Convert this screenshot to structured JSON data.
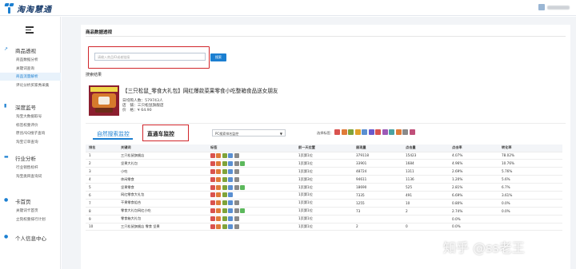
{
  "app": {
    "title": "淘淘慧通"
  },
  "sidebar": {
    "sections": [
      {
        "label": "商品透视",
        "icon": "chart-line-icon",
        "items": [
          "商品数据分析",
          "关键词查询",
          "商品流量解析",
          "评论分析买家秀采集"
        ]
      },
      {
        "label": "深度监号",
        "icon": "chart-bar-icon",
        "items": [
          "淘宝大数据取号",
          "标签权重评价",
          "原创/QQ搜子查询",
          "淘宝订单查询"
        ]
      },
      {
        "label": "行业分析",
        "icon": "folder-icon",
        "items": [
          "行业销售标杆",
          "淘宝类目查询词"
        ]
      },
      {
        "label": "卡首页",
        "icon": "info-icon",
        "items": [
          "关键词卡首页",
          "立刻权重排行计划"
        ]
      },
      {
        "label": "个人信息中心",
        "icon": "user-icon",
        "items": []
      }
    ]
  },
  "panel": {
    "title": "商品数据透视",
    "search_placeholder": "请输入商品ID或者链接",
    "search_button": "搜索",
    "result_label": "搜索结果"
  },
  "product": {
    "title": "【三只松鼠_零食大礼包】网红爆款菜果零食小吃整箱食品送女朋友",
    "sales": "日均购人数：579743人",
    "shop": "店　铺：三只松鼠旗舰店",
    "price": "价　格：¥ 64.90"
  },
  "tabs": {
    "organic": "自然搜索监控",
    "paid": "直通车监控"
  },
  "select": {
    "value": "PC搜索排名监控"
  },
  "filter_label": "选择标签：",
  "filter_colors": [
    "#d9534f",
    "#e07b39",
    "#7fa33a",
    "#e0a12a",
    "#5a8fd1",
    "#6a5acd",
    "#d9534f",
    "#9c59b6",
    "#4aa3a3",
    "#e07b39",
    "#8a8a8a",
    "#c04f7a"
  ],
  "table": {
    "headers": [
      "排名",
      "关键词",
      "标签",
      "前一天位置",
      "展现量",
      "点击量",
      "点击率",
      "转化率"
    ],
    "rows": [
      {
        "rank": "1",
        "kw": "三只松鼠旗舰店",
        "tags": [
          "#d9534f",
          "#e07b39",
          "#7fa33a",
          "#5a8fd1",
          "#8a8a8a"
        ],
        "pos": "1页第1位",
        "imp": "379118",
        "clk": "15423",
        "ctr": "4.07%",
        "cvr": "78.02%"
      },
      {
        "rank": "2",
        "kw": "坚果大礼包",
        "tags": [
          "#d9534f",
          "#e07b39",
          "#7fa33a",
          "#5a8fd1",
          "#8a8a8a",
          "#5cb85c"
        ],
        "pos": "1页第1位",
        "imp": "33901",
        "clk": "1684",
        "ctr": "4.96%",
        "cvr": "10.76%"
      },
      {
        "rank": "3",
        "kw": "小吃",
        "tags": [
          "#d9534f",
          "#e07b39",
          "#7fa33a",
          "#5a8fd1",
          "#8a8a8a"
        ],
        "pos": "1页第1位",
        "imp": "48724",
        "clk": "1311",
        "ctr": "2.69%",
        "cvr": "5.76%"
      },
      {
        "rank": "4",
        "kw": "休闲零食",
        "tags": [
          "#d9534f",
          "#e07b39",
          "#7fa33a",
          "#5a8fd1",
          "#8a8a8a"
        ],
        "pos": "1页第3位",
        "imp": "94611",
        "clk": "1136",
        "ctr": "1.20%",
        "cvr": "5.6%"
      },
      {
        "rank": "5",
        "kw": "坚果零食",
        "tags": [
          "#d9534f",
          "#e07b39",
          "#7fa33a",
          "#5a8fd1",
          "#8a8a8a",
          "#5cb85c"
        ],
        "pos": "1页第1位",
        "imp": "18690",
        "clk": "525",
        "ctr": "2.81%",
        "cvr": "6.7%"
      },
      {
        "rank": "6",
        "kw": "网红零食大礼包",
        "tags": [
          "#d9534f",
          "#e07b39",
          "#7fa33a",
          "#5a8fd1"
        ],
        "pos": "1页第1位",
        "imp": "7335",
        "clk": "491",
        "ctr": "6.69%",
        "cvr": "3.61%"
      },
      {
        "rank": "7",
        "kw": "干果零食组合",
        "tags": [
          "#d9534f",
          "#e07b39",
          "#7fa33a",
          "#5a8fd1",
          "#8a8a8a"
        ],
        "pos": "1页第1位",
        "imp": "1255",
        "clk": "10",
        "ctr": "0.80%",
        "cvr": "0.0%"
      },
      {
        "rank": "8",
        "kw": "零食大礼包网红小吃",
        "tags": [
          "#d9534f",
          "#e07b39",
          "#7fa33a",
          "#5a8fd1",
          "#8a8a8a",
          "#5cb85c"
        ],
        "pos": "1页第1位",
        "imp": "73",
        "clk": "2",
        "ctr": "2.74%",
        "cvr": "0.0%"
      },
      {
        "rank": "9",
        "kw": "零食箱大礼包",
        "tags": [
          "#d9534f",
          "#e07b39",
          "#7fa33a",
          "#5a8fd1",
          "#8a8a8a"
        ],
        "pos": "1页第1位",
        "imp": "",
        "clk": "",
        "ctr": "0.0%",
        "cvr": ""
      },
      {
        "rank": "10",
        "kw": "三只松鼠旗舰店 零食 坚果",
        "tags": [
          "#d9534f",
          "#e07b39",
          "#7fa33a",
          "#5a8fd1",
          "#8a8a8a"
        ],
        "pos": "1页第1位",
        "imp": "2",
        "clk": "0",
        "ctr": "0.0%",
        "cvr": ""
      }
    ]
  },
  "watermark": "知乎 @ss老王"
}
